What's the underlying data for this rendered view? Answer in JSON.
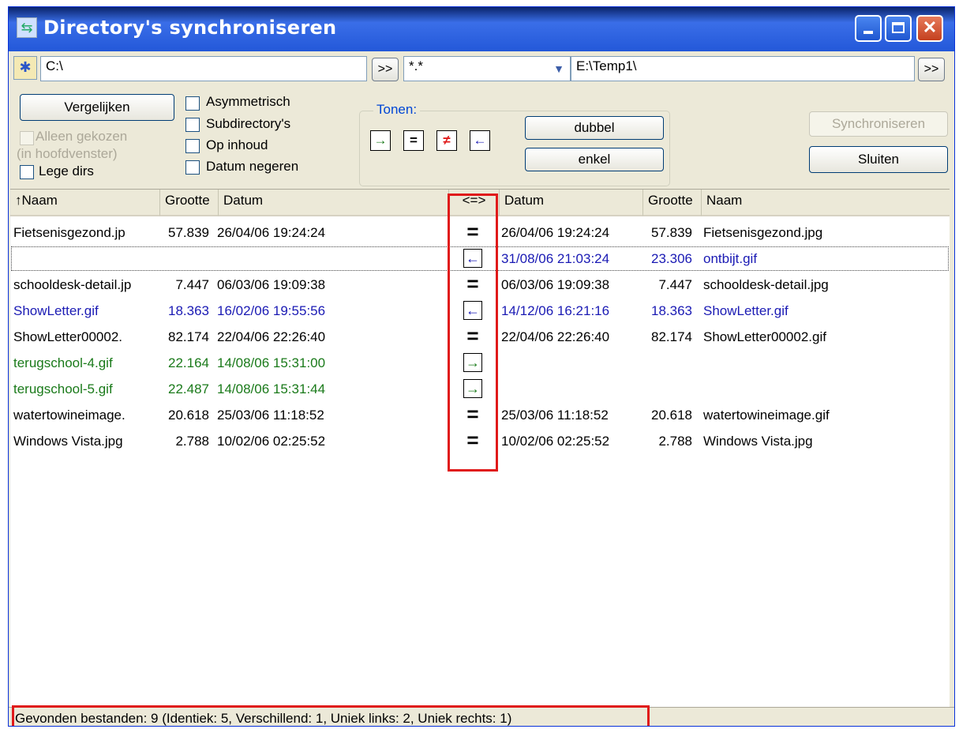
{
  "title": "Directory's synchroniseren",
  "left_path": "C:\\",
  "right_path": "E:\\Temp1\\",
  "filter": "*.*",
  "nav_btn": ">>",
  "buttons": {
    "compare": "Vergelijken",
    "synchronize": "Synchroniseren",
    "close": "Sluiten",
    "double": "dubbel",
    "single": "enkel"
  },
  "checkboxes": {
    "asymmetric": "Asymmetrisch",
    "subdirs": "Subdirectory's",
    "by_content": "Op inhoud",
    "ignore_date": "Datum negeren",
    "only_selected_1": "Alleen gekozen",
    "only_selected_2": "(in hoofdvenster)",
    "empty_dirs": "Lege dirs"
  },
  "show_group": "Tonen:",
  "columns": {
    "left_name": "↑Naam",
    "left_size": "Grootte",
    "left_date": "Datum",
    "compare": "<=>",
    "right_date": "Datum",
    "right_size": "Grootte",
    "right_name": "Naam"
  },
  "colors": {
    "black": "#000000",
    "blue": "#1a1ab4",
    "green": "#1a7a1a",
    "highlight": "#e01a1a"
  },
  "rows": [
    {
      "lname": "Fietsenisgezond.jp",
      "lsize": "57.839",
      "ldate": "26/04/06 19:24:24",
      "cmp": "=",
      "cmp_icon": "equal-icon",
      "rdate": "26/04/06 19:24:24",
      "rsize": "57.839",
      "rname": "Fietsenisgezond.jpg",
      "color": "black"
    },
    {
      "lname": "",
      "lsize": "",
      "ldate": "",
      "cmp": "←",
      "cmp_icon": "left-arrow-icon",
      "rdate": "31/08/06 21:03:24",
      "rsize": "23.306",
      "rname": "ontbijt.gif",
      "color": "blue"
    },
    {
      "lname": "schooldesk-detail.jp",
      "lsize": "7.447",
      "ldate": "06/03/06 19:09:38",
      "cmp": "=",
      "cmp_icon": "equal-icon",
      "rdate": "06/03/06 19:09:38",
      "rsize": "7.447",
      "rname": "schooldesk-detail.jpg",
      "color": "black"
    },
    {
      "lname": "ShowLetter.gif",
      "lsize": "18.363",
      "ldate": "16/02/06 19:55:56",
      "cmp": "←",
      "cmp_icon": "left-arrow-icon",
      "rdate": "14/12/06 16:21:16",
      "rsize": "18.363",
      "rname": "ShowLetter.gif",
      "color": "blue"
    },
    {
      "lname": "ShowLetter00002.",
      "lsize": "82.174",
      "ldate": "22/04/06 22:26:40",
      "cmp": "=",
      "cmp_icon": "equal-icon",
      "rdate": "22/04/06 22:26:40",
      "rsize": "82.174",
      "rname": "ShowLetter00002.gif",
      "color": "black"
    },
    {
      "lname": "terugschool-4.gif",
      "lsize": "22.164",
      "ldate": "14/08/06 15:31:00",
      "cmp": "→",
      "cmp_icon": "right-arrow-icon",
      "rdate": "",
      "rsize": "",
      "rname": "",
      "color": "green"
    },
    {
      "lname": "terugschool-5.gif",
      "lsize": "22.487",
      "ldate": "14/08/06 15:31:44",
      "cmp": "→",
      "cmp_icon": "right-arrow-icon",
      "rdate": "",
      "rsize": "",
      "rname": "",
      "color": "green"
    },
    {
      "lname": "watertowineimage.",
      "lsize": "20.618",
      "ldate": "25/03/06 11:18:52",
      "cmp": "=",
      "cmp_icon": "equal-icon",
      "rdate": "25/03/06 11:18:52",
      "rsize": "20.618",
      "rname": "watertowineimage.gif",
      "color": "black"
    },
    {
      "lname": "Windows Vista.jpg",
      "lsize": "2.788",
      "ldate": "10/02/06 02:25:52",
      "cmp": "=",
      "cmp_icon": "equal-icon",
      "rdate": "10/02/06 02:25:52",
      "rsize": "2.788",
      "rname": "Windows Vista.jpg",
      "color": "black"
    }
  ],
  "status": "Gevonden bestanden: 9  (Identiek: 5, Verschillend: 1, Uniek links: 2, Uniek rechts: 1)"
}
